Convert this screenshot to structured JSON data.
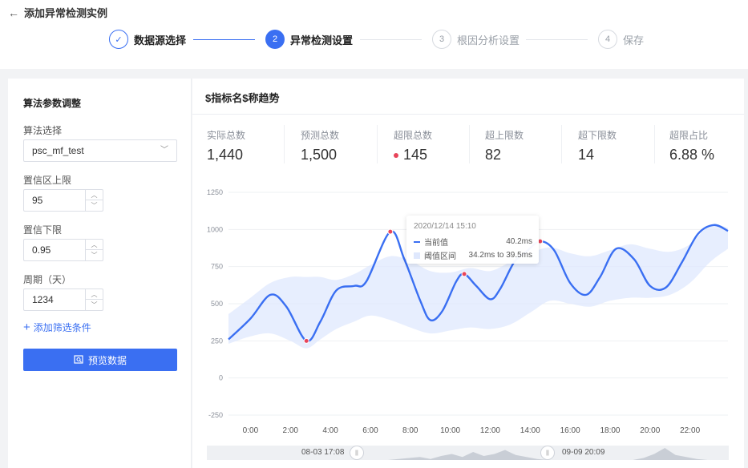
{
  "header": {
    "back_icon": "←",
    "title": "添加异常检测实例"
  },
  "steps": [
    {
      "num": "✓",
      "label": "数据源选择",
      "state": "done"
    },
    {
      "num": "2",
      "label": "异常检测设置",
      "state": "active"
    },
    {
      "num": "3",
      "label": "根因分析设置",
      "state": "todo"
    },
    {
      "num": "4",
      "label": "保存",
      "state": "todo"
    }
  ],
  "left_panel": {
    "title": "算法参数调整",
    "algorithm_label": "算法选择",
    "algorithm_value": "psc_mf_test",
    "upper_label": "置信区上限",
    "upper_value": "95",
    "lower_label": "置信下限",
    "lower_value": "0.95",
    "period_label": "周期（天）",
    "period_value": "1234",
    "add_filter": "添加筛选条件",
    "preview_button": "预览数据",
    "icons": {
      "add": "plus-icon",
      "preview": "preview-icon",
      "dropdown": "chevron-down-icon"
    }
  },
  "chart_panel": {
    "title": "$指标名$称趋势",
    "stats": [
      {
        "label": "实际总数",
        "value": "1,440"
      },
      {
        "label": "预测总数",
        "value": "1,500"
      },
      {
        "label": "超限总数",
        "value": "145",
        "dot": true
      },
      {
        "label": "超上限数",
        "value": "82"
      },
      {
        "label": "超下限数",
        "value": "14"
      },
      {
        "label": "超限占比",
        "value": "6.88 %"
      }
    ],
    "tooltip": {
      "time": "2020/12/14 15:10",
      "current_label": "当前值",
      "current_value": "40.2ms",
      "band_label": "阈值区间",
      "band_value": "34.2ms to  39.5ms"
    },
    "scroller": {
      "start_label": "08-03 17:08",
      "end_label": "09-09 20:09"
    }
  },
  "colors": {
    "accent": "#3a6ff2",
    "anomaly": "#e8455a",
    "band": "#dfe8fd"
  },
  "chart_data": {
    "type": "line",
    "ylim": [
      -250,
      1250
    ],
    "yticks": [
      "1250",
      "1000",
      "750",
      "500",
      "250",
      "0",
      "-250"
    ],
    "xticks": [
      "0:00",
      "2:00",
      "4:00",
      "6:00",
      "8:00",
      "10:00",
      "12:00",
      "14:00",
      "16:00",
      "18:00",
      "20:00",
      "22:00"
    ],
    "xrange": [
      -1.1,
      23.9
    ],
    "series": [
      {
        "x": [
          -1.1,
          0,
          1,
          1.8,
          2.8,
          3.5,
          4.3,
          5.2,
          5.8,
          7,
          7.7,
          8.5,
          9.0,
          9.6,
          10.3,
          10.7,
          11.3,
          12.0,
          12.5,
          13.2,
          13.8,
          14.5,
          15.2,
          16.0,
          16.8,
          17.5,
          18.3,
          19.2,
          20.0,
          20.8,
          21.6,
          22.4,
          23.2,
          23.9
        ],
        "y": [
          260,
          400,
          560,
          480,
          250,
          380,
          590,
          620,
          650,
          985,
          800,
          520,
          390,
          450,
          650,
          700,
          620,
          530,
          600,
          780,
          850,
          920,
          860,
          640,
          560,
          680,
          870,
          800,
          620,
          610,
          780,
          970,
          1030,
          990
        ]
      }
    ],
    "band": {
      "x": [
        -1.1,
        0,
        1,
        2,
        2.8,
        3.5,
        4.3,
        5.2,
        6,
        7,
        8,
        9,
        10,
        11,
        12,
        13,
        14,
        15,
        16,
        17,
        18,
        19,
        20,
        21,
        22,
        23,
        23.9
      ],
      "lower": [
        230,
        280,
        300,
        250,
        200,
        260,
        330,
        380,
        420,
        390,
        340,
        300,
        320,
        340,
        330,
        360,
        440,
        520,
        500,
        480,
        520,
        540,
        540,
        560,
        640,
        780,
        870
      ],
      "upper": [
        430,
        540,
        640,
        680,
        680,
        680,
        660,
        700,
        760,
        820,
        790,
        720,
        710,
        740,
        720,
        780,
        840,
        880,
        840,
        820,
        860,
        900,
        870,
        850,
        900,
        1030,
        1010
      ]
    },
    "anomalies": [
      {
        "x": 2.8,
        "y": 250
      },
      {
        "x": 7,
        "y": 985
      },
      {
        "x": 10.7,
        "y": 700
      },
      {
        "x": 14.5,
        "y": 920
      }
    ],
    "mini": [
      0,
      0,
      0,
      0,
      0,
      0,
      0,
      0,
      0,
      0,
      0,
      0,
      0,
      0,
      0,
      0,
      0,
      0,
      1,
      2,
      3,
      1,
      4,
      6,
      3,
      8,
      4,
      6,
      10,
      5,
      3,
      1,
      0,
      0,
      0,
      0,
      0,
      0,
      0,
      0,
      0,
      2,
      6,
      12,
      5,
      3,
      1,
      0,
      0,
      0
    ]
  }
}
